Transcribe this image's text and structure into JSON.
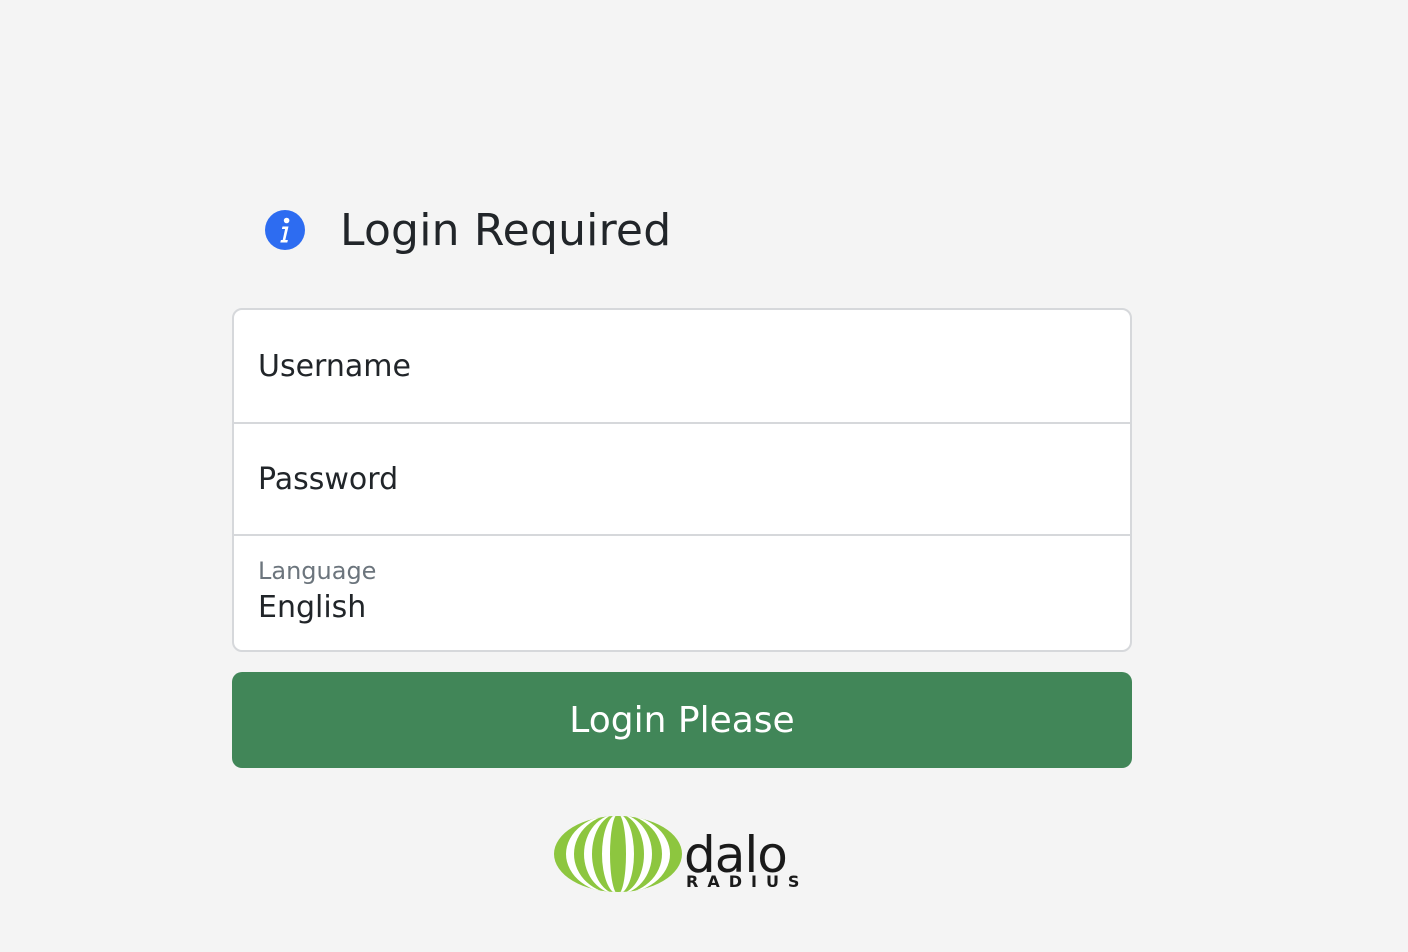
{
  "heading": {
    "icon": "info-circle-icon",
    "title": "Login Required"
  },
  "form": {
    "username": {
      "placeholder": "Username",
      "value": ""
    },
    "password": {
      "placeholder": "Password",
      "value": ""
    },
    "language": {
      "label": "Language",
      "selected": "English"
    }
  },
  "login_button": {
    "label": "Login Please"
  },
  "logo": {
    "brand_text": "dalo",
    "brand_subtext": "RADIUS"
  },
  "colors": {
    "background": "#f4f4f4",
    "primary_button": "#418658",
    "info_icon": "#2d6cf1",
    "logo_green": "#8dc63f"
  }
}
